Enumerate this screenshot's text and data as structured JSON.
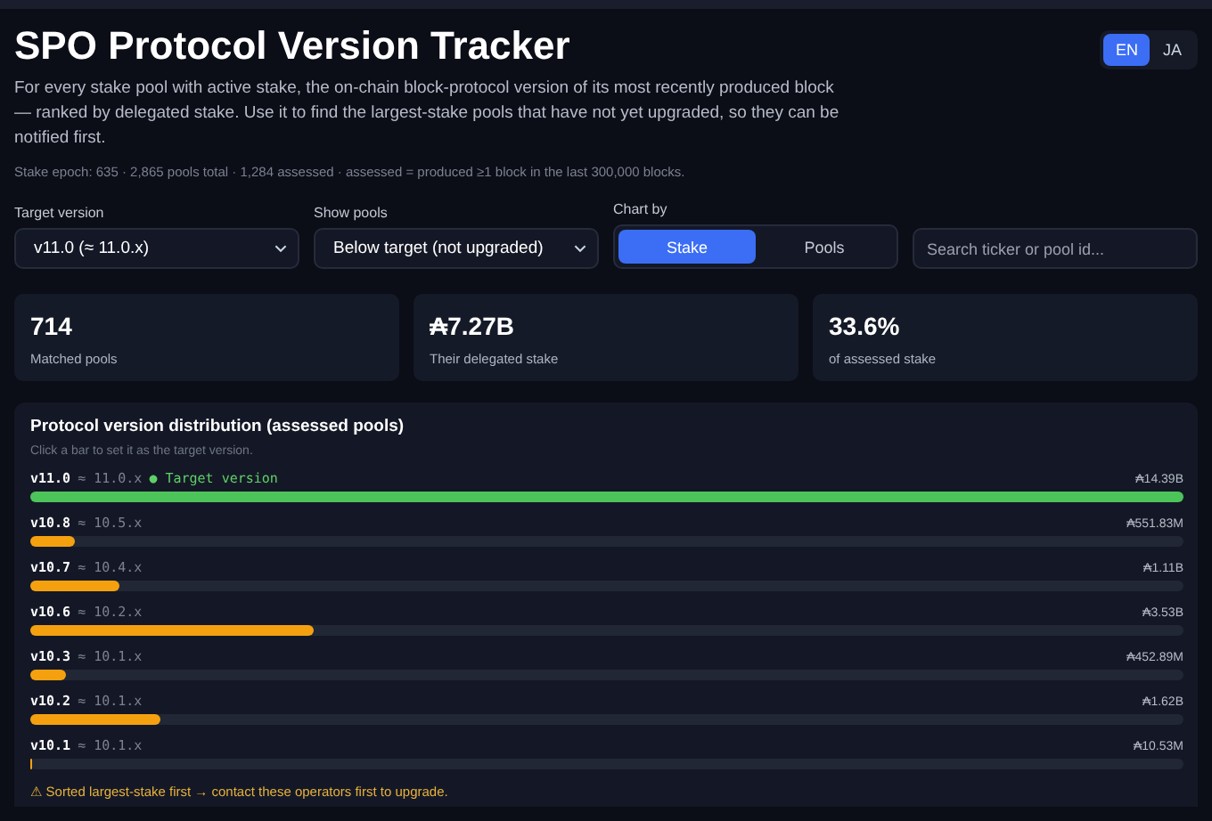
{
  "header": {
    "title": "SPO Protocol Version Tracker",
    "languages": [
      {
        "label": "EN",
        "selected": true
      },
      {
        "label": "JA",
        "selected": false
      }
    ],
    "description": "For every stake pool with active stake, the on-chain block-protocol version of its most recently produced block — ranked by delegated stake. Use it to find the largest-stake pools that have not yet upgraded, so they can be notified first.",
    "meta": "Stake epoch: 635 · 2,865 pools total · 1,284 assessed · assessed = produced ≥1 block in the last 300,000 blocks."
  },
  "controls": {
    "target_version": {
      "label": "Target version",
      "value": "v11.0 (≈ 11.0.x)"
    },
    "show_pools": {
      "label": "Show pools",
      "value": "Below target (not upgraded)"
    },
    "chart_by": {
      "label": "Chart by",
      "options": [
        {
          "label": "Stake",
          "selected": true
        },
        {
          "label": "Pools",
          "selected": false
        }
      ]
    },
    "search": {
      "placeholder": "Search ticker or pool id..."
    }
  },
  "stats": [
    {
      "value": "714",
      "label": "Matched pools"
    },
    {
      "value": "₳7.27B",
      "label": "Their delegated stake"
    },
    {
      "value": "33.6%",
      "label": "of assessed stake"
    }
  ],
  "distribution": {
    "title": "Protocol version distribution (assessed pools)",
    "hint": "Click a bar to set it as the target version.",
    "rows": [
      {
        "version": "v11.0",
        "approx": "≈ 11.0.x",
        "target": true,
        "note": "● Target version",
        "amount": "₳14.39B",
        "level": 1
      },
      {
        "version": "v10.8",
        "approx": "≈ 10.5.x",
        "target": false,
        "amount": "₳551.83M",
        "level": 0.038
      },
      {
        "version": "v10.7",
        "approx": "≈ 10.4.x",
        "target": false,
        "amount": "₳1.11B",
        "level": 0.077
      },
      {
        "version": "v10.6",
        "approx": "≈ 10.2.x",
        "target": false,
        "amount": "₳3.53B",
        "level": 0.245
      },
      {
        "version": "v10.3",
        "approx": "≈ 10.1.x",
        "target": false,
        "amount": "₳452.89M",
        "level": 0.031
      },
      {
        "version": "v10.2",
        "approx": "≈ 10.1.x",
        "target": false,
        "amount": "₳1.62B",
        "level": 0.113
      },
      {
        "version": "v10.1",
        "approx": "≈ 10.1.x",
        "target": false,
        "amount": "₳10.53M",
        "level": 0.002
      }
    ],
    "footer": "⚠ Sorted largest-stake first → contact these operators first to upgrade."
  }
}
